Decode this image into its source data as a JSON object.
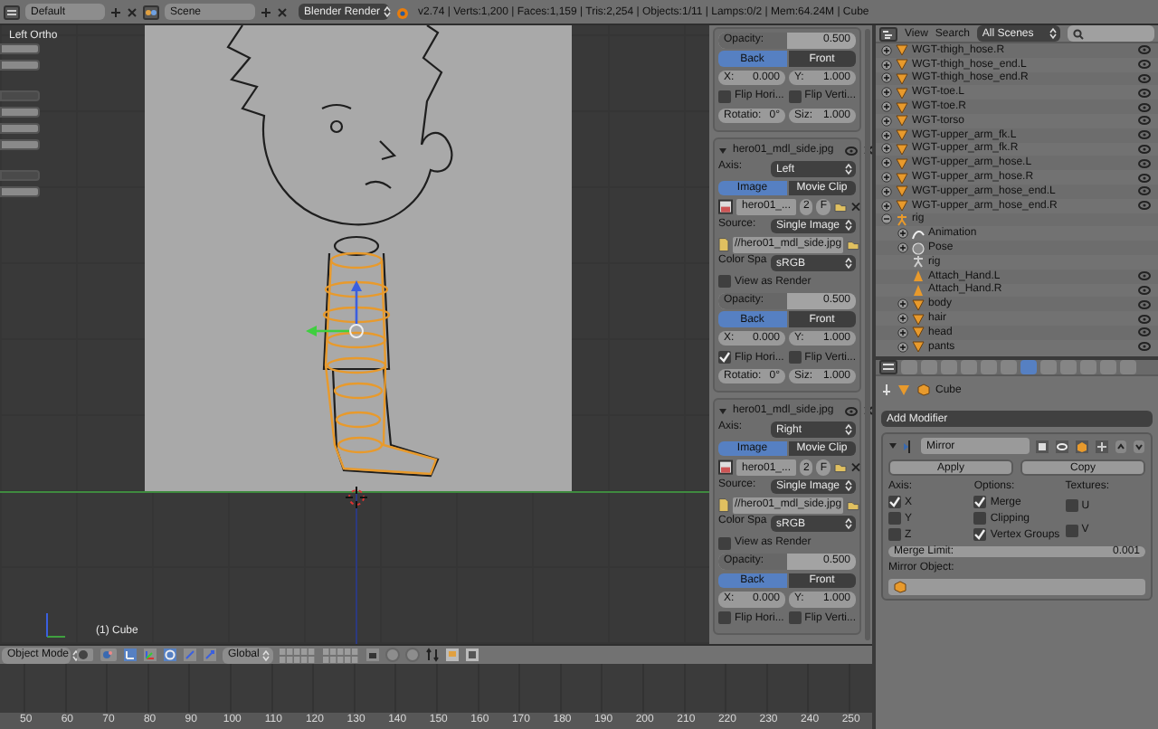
{
  "top_bar": {
    "screen_layout": "Default",
    "scene": "Scene",
    "render_engine": "Blender Render",
    "info": "v2.74 | Verts:1,200 | Faces:1,159 | Tris:2,254 | Objects:1/11 | Lamps:0/2 | Mem:64.24M | Cube"
  },
  "viewport": {
    "view_name": "Left Ortho",
    "object_label": "(1) Cube",
    "header": {
      "mode": "Object Mode",
      "orientation": "Global"
    }
  },
  "n_panel": {
    "blocks": [
      {
        "rows": [
          {
            "kind": "slider",
            "label": "Opacity:",
            "value": "0.500",
            "level": 0.5
          },
          {
            "kind": "toggle",
            "options": [
              {
                "label": "Back",
                "selected": true
              },
              {
                "label": "Front",
                "selected": false
              }
            ]
          },
          {
            "kind": "pair",
            "items": [
              {
                "label": "X:",
                "value": "0.000"
              },
              {
                "label": "Y:",
                "value": "1.000"
              }
            ]
          },
          {
            "kind": "checks",
            "items": [
              {
                "label": "Flip Hori...",
                "checked": false
              },
              {
                "label": "Flip Verti...",
                "checked": false
              }
            ]
          },
          {
            "kind": "pair",
            "items": [
              {
                "label": "Rotatio:",
                "value": "0°"
              },
              {
                "label": "Siz:",
                "value": "1.000"
              }
            ]
          }
        ]
      },
      {
        "title": "hero01_mdl_side.jpg",
        "rows": [
          {
            "kind": "dropdown",
            "label": "Axis:",
            "value": "Left"
          },
          {
            "kind": "toggle",
            "options": [
              {
                "label": "Image",
                "selected": true
              },
              {
                "label": "Movie Clip",
                "selected": false
              }
            ]
          },
          {
            "kind": "image",
            "name": "hero01_...",
            "users": "2",
            "fake": "F"
          },
          {
            "kind": "dropdown",
            "label": "Source:",
            "value": "Single Image"
          },
          {
            "kind": "path",
            "value": "//hero01_mdl_side.jpg"
          },
          {
            "kind": "dropdown",
            "label": "Color Spa",
            "value": "sRGB"
          },
          {
            "kind": "check",
            "label": "View as Render",
            "checked": false
          },
          {
            "kind": "slider",
            "label": "Opacity:",
            "value": "0.500",
            "level": 0.5
          },
          {
            "kind": "toggle",
            "options": [
              {
                "label": "Back",
                "selected": true
              },
              {
                "label": "Front",
                "selected": false
              }
            ]
          },
          {
            "kind": "pair",
            "items": [
              {
                "label": "X:",
                "value": "0.000"
              },
              {
                "label": "Y:",
                "value": "1.000"
              }
            ]
          },
          {
            "kind": "checks",
            "items": [
              {
                "label": "Flip Hori...",
                "checked": true
              },
              {
                "label": "Flip Verti...",
                "checked": false
              }
            ]
          },
          {
            "kind": "pair",
            "items": [
              {
                "label": "Rotatio:",
                "value": "0°"
              },
              {
                "label": "Siz:",
                "value": "1.000"
              }
            ]
          }
        ]
      },
      {
        "title": "hero01_mdl_side.jpg",
        "rows": [
          {
            "kind": "dropdown",
            "label": "Axis:",
            "value": "Right"
          },
          {
            "kind": "toggle",
            "options": [
              {
                "label": "Image",
                "selected": true
              },
              {
                "label": "Movie Clip",
                "selected": false
              }
            ]
          },
          {
            "kind": "image",
            "name": "hero01_...",
            "users": "2",
            "fake": "F"
          },
          {
            "kind": "dropdown",
            "label": "Source:",
            "value": "Single Image"
          },
          {
            "kind": "path",
            "value": "//hero01_mdl_side.jpg"
          },
          {
            "kind": "dropdown",
            "label": "Color Spa",
            "value": "sRGB"
          },
          {
            "kind": "check",
            "label": "View as Render",
            "checked": false
          },
          {
            "kind": "slider",
            "label": "Opacity:",
            "value": "0.500",
            "level": 0.5
          },
          {
            "kind": "toggle",
            "options": [
              {
                "label": "Back",
                "selected": true
              },
              {
                "label": "Front",
                "selected": false
              }
            ]
          },
          {
            "kind": "pair",
            "items": [
              {
                "label": "X:",
                "value": "0.000"
              },
              {
                "label": "Y:",
                "value": "1.000"
              }
            ]
          },
          {
            "kind": "checks",
            "items": [
              {
                "label": "Flip Hori...",
                "checked": false
              },
              {
                "label": "Flip Verti...",
                "checked": false
              }
            ]
          }
        ]
      }
    ]
  },
  "timeline": {
    "ruler_labels": [
      "50",
      "60",
      "70",
      "80",
      "90",
      "100",
      "110",
      "120",
      "130",
      "140",
      "150",
      "160",
      "170",
      "180",
      "190",
      "200",
      "210",
      "220",
      "230",
      "240",
      "250"
    ]
  },
  "outliner": {
    "header": {
      "menus": [
        "View",
        "Search"
      ],
      "scene_filter": "All Scenes"
    },
    "items": [
      {
        "label": "WGT-thigh_hose.R",
        "kind": "object",
        "expanded": false
      },
      {
        "label": "WGT-thigh_hose_end.L",
        "kind": "object",
        "expanded": false
      },
      {
        "label": "WGT-thigh_hose_end.R",
        "kind": "object",
        "expanded": false
      },
      {
        "label": "WGT-toe.L",
        "kind": "object",
        "expanded": false
      },
      {
        "label": "WGT-toe.R",
        "kind": "object",
        "expanded": false
      },
      {
        "label": "WGT-torso",
        "kind": "object",
        "expanded": false
      },
      {
        "label": "WGT-upper_arm_fk.L",
        "kind": "object",
        "expanded": false
      },
      {
        "label": "WGT-upper_arm_fk.R",
        "kind": "object",
        "expanded": false
      },
      {
        "label": "WGT-upper_arm_hose.L",
        "kind": "object",
        "expanded": false
      },
      {
        "label": "WGT-upper_arm_hose.R",
        "kind": "object",
        "expanded": false
      },
      {
        "label": "WGT-upper_arm_hose_end.L",
        "kind": "object",
        "expanded": false
      },
      {
        "label": "WGT-upper_arm_hose_end.R",
        "kind": "object",
        "expanded": false
      },
      {
        "label": "rig",
        "kind": "armature",
        "expanded": true,
        "children": [
          {
            "label": "Animation",
            "kind": "animation",
            "expanded": false
          },
          {
            "label": "Pose",
            "kind": "pose",
            "expanded": false
          },
          {
            "label": "rig",
            "kind": "armature_data"
          },
          {
            "label": "Attach_Hand.L",
            "kind": "bone"
          },
          {
            "label": "Attach_Hand.R",
            "kind": "bone"
          },
          {
            "label": "body",
            "kind": "object",
            "expanded": false
          },
          {
            "label": "hair",
            "kind": "object",
            "expanded": false
          },
          {
            "label": "head",
            "kind": "object",
            "expanded": false
          },
          {
            "label": "pants",
            "kind": "object",
            "expanded": false
          }
        ]
      }
    ]
  },
  "properties": {
    "tabs": [
      {
        "selected": false
      },
      {
        "selected": false
      },
      {
        "selected": false
      },
      {
        "selected": false
      },
      {
        "selected": false
      },
      {
        "selected": false
      },
      {
        "selected": true
      },
      {
        "selected": false
      },
      {
        "selected": false
      },
      {
        "selected": false
      },
      {
        "selected": false
      },
      {
        "selected": false
      }
    ],
    "breadcrumb": "Cube",
    "add_modifier": "Add Modifier",
    "modifier": {
      "name": "Mirror",
      "buttons": [
        "Apply",
        "Copy"
      ],
      "groups": [
        {
          "title": "Axis:",
          "options": [
            {
              "label": "X",
              "checked": true
            },
            {
              "label": "Y",
              "checked": false
            },
            {
              "label": "Z",
              "checked": false
            }
          ]
        },
        {
          "title": "Options:",
          "options": [
            {
              "label": "Merge",
              "checked": true
            },
            {
              "label": "Clipping",
              "checked": false
            },
            {
              "label": "Vertex Groups",
              "checked": true
            }
          ]
        },
        {
          "title": "Textures:",
          "options": [
            {
              "label": "U",
              "checked": false
            },
            {
              "label": "V",
              "checked": false
            }
          ]
        }
      ],
      "merge_limit": {
        "label": "Merge Limit:",
        "value": "0.001"
      },
      "mirror_object": {
        "label": "Mirror Object:"
      }
    }
  }
}
